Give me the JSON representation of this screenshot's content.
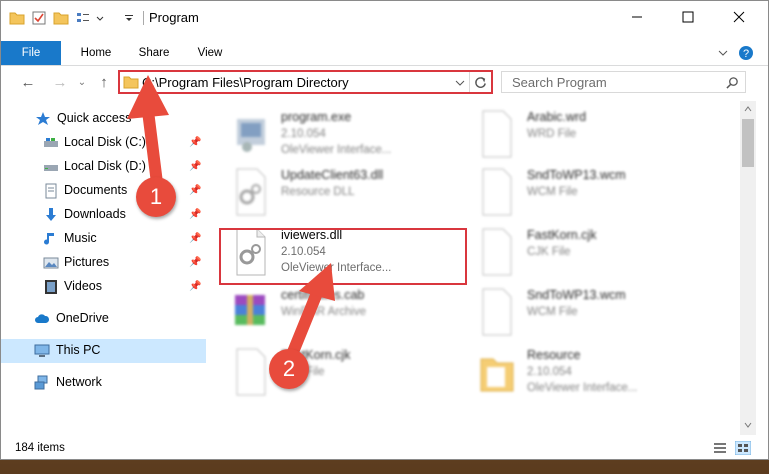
{
  "window": {
    "title": "Program"
  },
  "ribbon": {
    "tabs": [
      "File",
      "Home",
      "Share",
      "View"
    ]
  },
  "address": {
    "path": "C:\\Program Files\\Program Directory"
  },
  "search": {
    "placeholder": "Search Program"
  },
  "nav": {
    "quick_access": "Quick access",
    "items": [
      {
        "label": "Local Disk (C:)",
        "icon": "drive-icon"
      },
      {
        "label": "Local Disk (D:)",
        "icon": "drive-icon"
      },
      {
        "label": "Documents",
        "icon": "documents-icon"
      },
      {
        "label": "Downloads",
        "icon": "downloads-icon"
      },
      {
        "label": "Music",
        "icon": "music-icon"
      },
      {
        "label": "Pictures",
        "icon": "pictures-icon"
      },
      {
        "label": "Videos",
        "icon": "videos-icon"
      }
    ],
    "onedrive": "OneDrive",
    "this_pc": "This PC",
    "network": "Network"
  },
  "files": {
    "left": [
      {
        "name": "program.exe",
        "l2": "2.10.054",
        "l3": "OleViewer Interface..."
      },
      {
        "name": "UpdateClient63.dll",
        "l2": "Resource DLL",
        "l3": ""
      },
      {
        "name": "iviewers.dll",
        "l2": "2.10.054",
        "l3": "OleViewer Interface..."
      },
      {
        "name": "certificates.cab",
        "l2": "WinRAR Archive",
        "l3": ""
      },
      {
        "name": "FastKorn.cjk",
        "l2": "CJK File",
        "l3": ""
      }
    ],
    "right": [
      {
        "name": "Arabic.wrd",
        "l2": "WRD File",
        "l3": ""
      },
      {
        "name": "SndToWP13.wcm",
        "l2": "WCM File",
        "l3": ""
      },
      {
        "name": "FastKorn.cjk",
        "l2": "CJK File",
        "l3": ""
      },
      {
        "name": "SndToWP13.wcm",
        "l2": "WCM File",
        "l3": ""
      },
      {
        "name": "Resource",
        "l2": "2.10.054",
        "l3": "OleViewer Interface..."
      }
    ]
  },
  "status": {
    "count": "184 items"
  },
  "callouts": {
    "one": "1",
    "two": "2"
  },
  "colors": {
    "accent": "#1979ca",
    "highlight": "#d9363e",
    "selection": "#cce8ff"
  }
}
